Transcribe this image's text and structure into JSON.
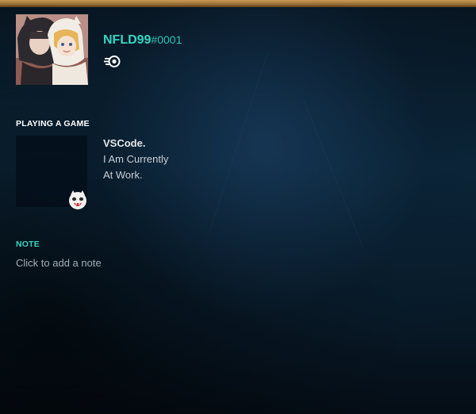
{
  "profile": {
    "username": "NFLD99",
    "discriminator": "#0001",
    "badge_icon": "nitro-icon"
  },
  "activity": {
    "section_label": "PLAYING A GAME",
    "game_name": "VSCode.",
    "details_line1": "I Am Currently",
    "details_line2": "At Work."
  },
  "note": {
    "section_label": "NOTE",
    "placeholder": "Click to add a note"
  },
  "colors": {
    "accent": "#37d6c3",
    "border": "#b8893f"
  }
}
